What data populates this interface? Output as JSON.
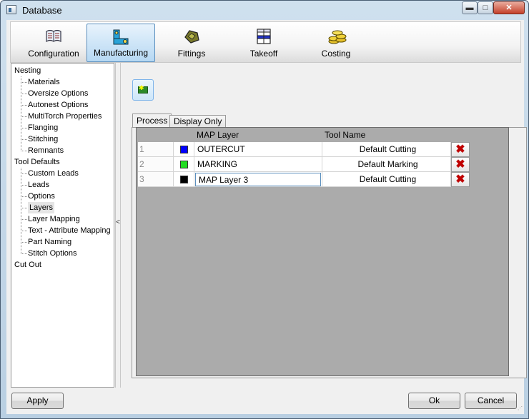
{
  "window": {
    "title": "Database",
    "minimize": "▬",
    "maximize": "□",
    "close": "✕"
  },
  "toolbar": [
    {
      "label": "Configuration",
      "icon": "book-icon",
      "active": false
    },
    {
      "label": "Manufacturing",
      "icon": "manufacturing-icon",
      "active": true
    },
    {
      "label": "Fittings",
      "icon": "fittings-icon",
      "active": false
    },
    {
      "label": "Takeoff",
      "icon": "takeoff-icon",
      "active": false
    },
    {
      "label": "Costing",
      "icon": "coins-icon",
      "active": false
    }
  ],
  "tree": {
    "nesting": {
      "label": "Nesting",
      "children": [
        "Materials",
        "Oversize Options",
        "Autonest Options",
        "MultiTorch Properties",
        "Flanging",
        "Stitching",
        "Remnants"
      ]
    },
    "tool_defaults": {
      "label": "Tool Defaults",
      "children": [
        "Custom Leads",
        "Leads",
        "Options",
        "Layers",
        "Layer Mapping",
        "Text - Attribute Mapping",
        "Part Naming",
        "Stitch Options"
      ]
    },
    "cut_out": {
      "label": "Cut Out"
    },
    "selected": "Layers"
  },
  "splitter_glyph": "<",
  "tabs": [
    "Process",
    "Display Only"
  ],
  "grid": {
    "headers": {
      "layer": "MAP Layer",
      "tool": "Tool Name"
    },
    "rows": [
      {
        "num": "1",
        "color": "#0000ff",
        "layer": "OUTERCUT",
        "tool": "Default Cutting"
      },
      {
        "num": "2",
        "color": "#22dd22",
        "layer": "MARKING",
        "tool": "Default Marking"
      },
      {
        "num": "3",
        "color": "#000000",
        "layer": "MAP Layer 3",
        "tool": "Default Cutting",
        "editing": true
      }
    ],
    "delete_glyph": "✖"
  },
  "buttons": {
    "apply": "Apply",
    "ok": "Ok",
    "cancel": "Cancel"
  }
}
